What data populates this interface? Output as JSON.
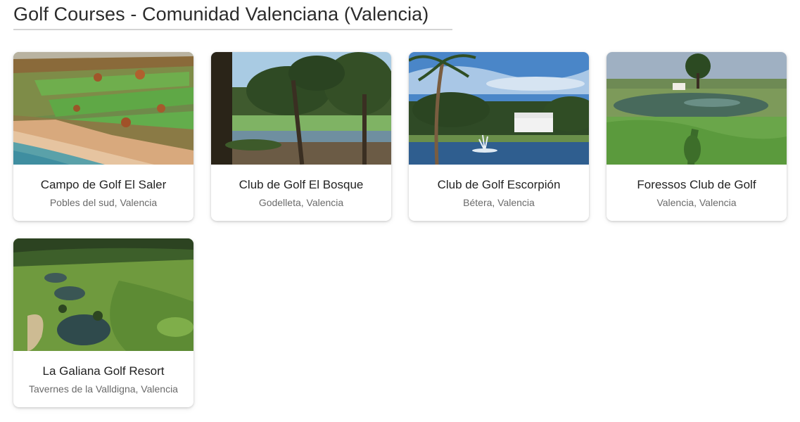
{
  "page": {
    "title": "Golf Courses - Comunidad Valenciana (Valencia)"
  },
  "courses": [
    {
      "name": "Campo de Golf El Saler",
      "location": "Pobles del sud, Valencia",
      "image": "aerial-coastal-golf-course-photo"
    },
    {
      "name": "Club de Golf El Bosque",
      "location": "Godelleta, Valencia",
      "image": "pine-framed-lake-golf-photo"
    },
    {
      "name": "Club de Golf Escorpión",
      "location": "Bétera, Valencia",
      "image": "palm-lake-fountain-clubhouse-photo"
    },
    {
      "name": "Foressos Club de Golf",
      "location": "Valencia, Valencia",
      "image": "pond-tree-green-photo"
    },
    {
      "name": "La Galiana Golf Resort",
      "location": "Tavernes de la Valldigna, Valencia",
      "image": "aerial-valley-lakes-golf-photo"
    }
  ]
}
